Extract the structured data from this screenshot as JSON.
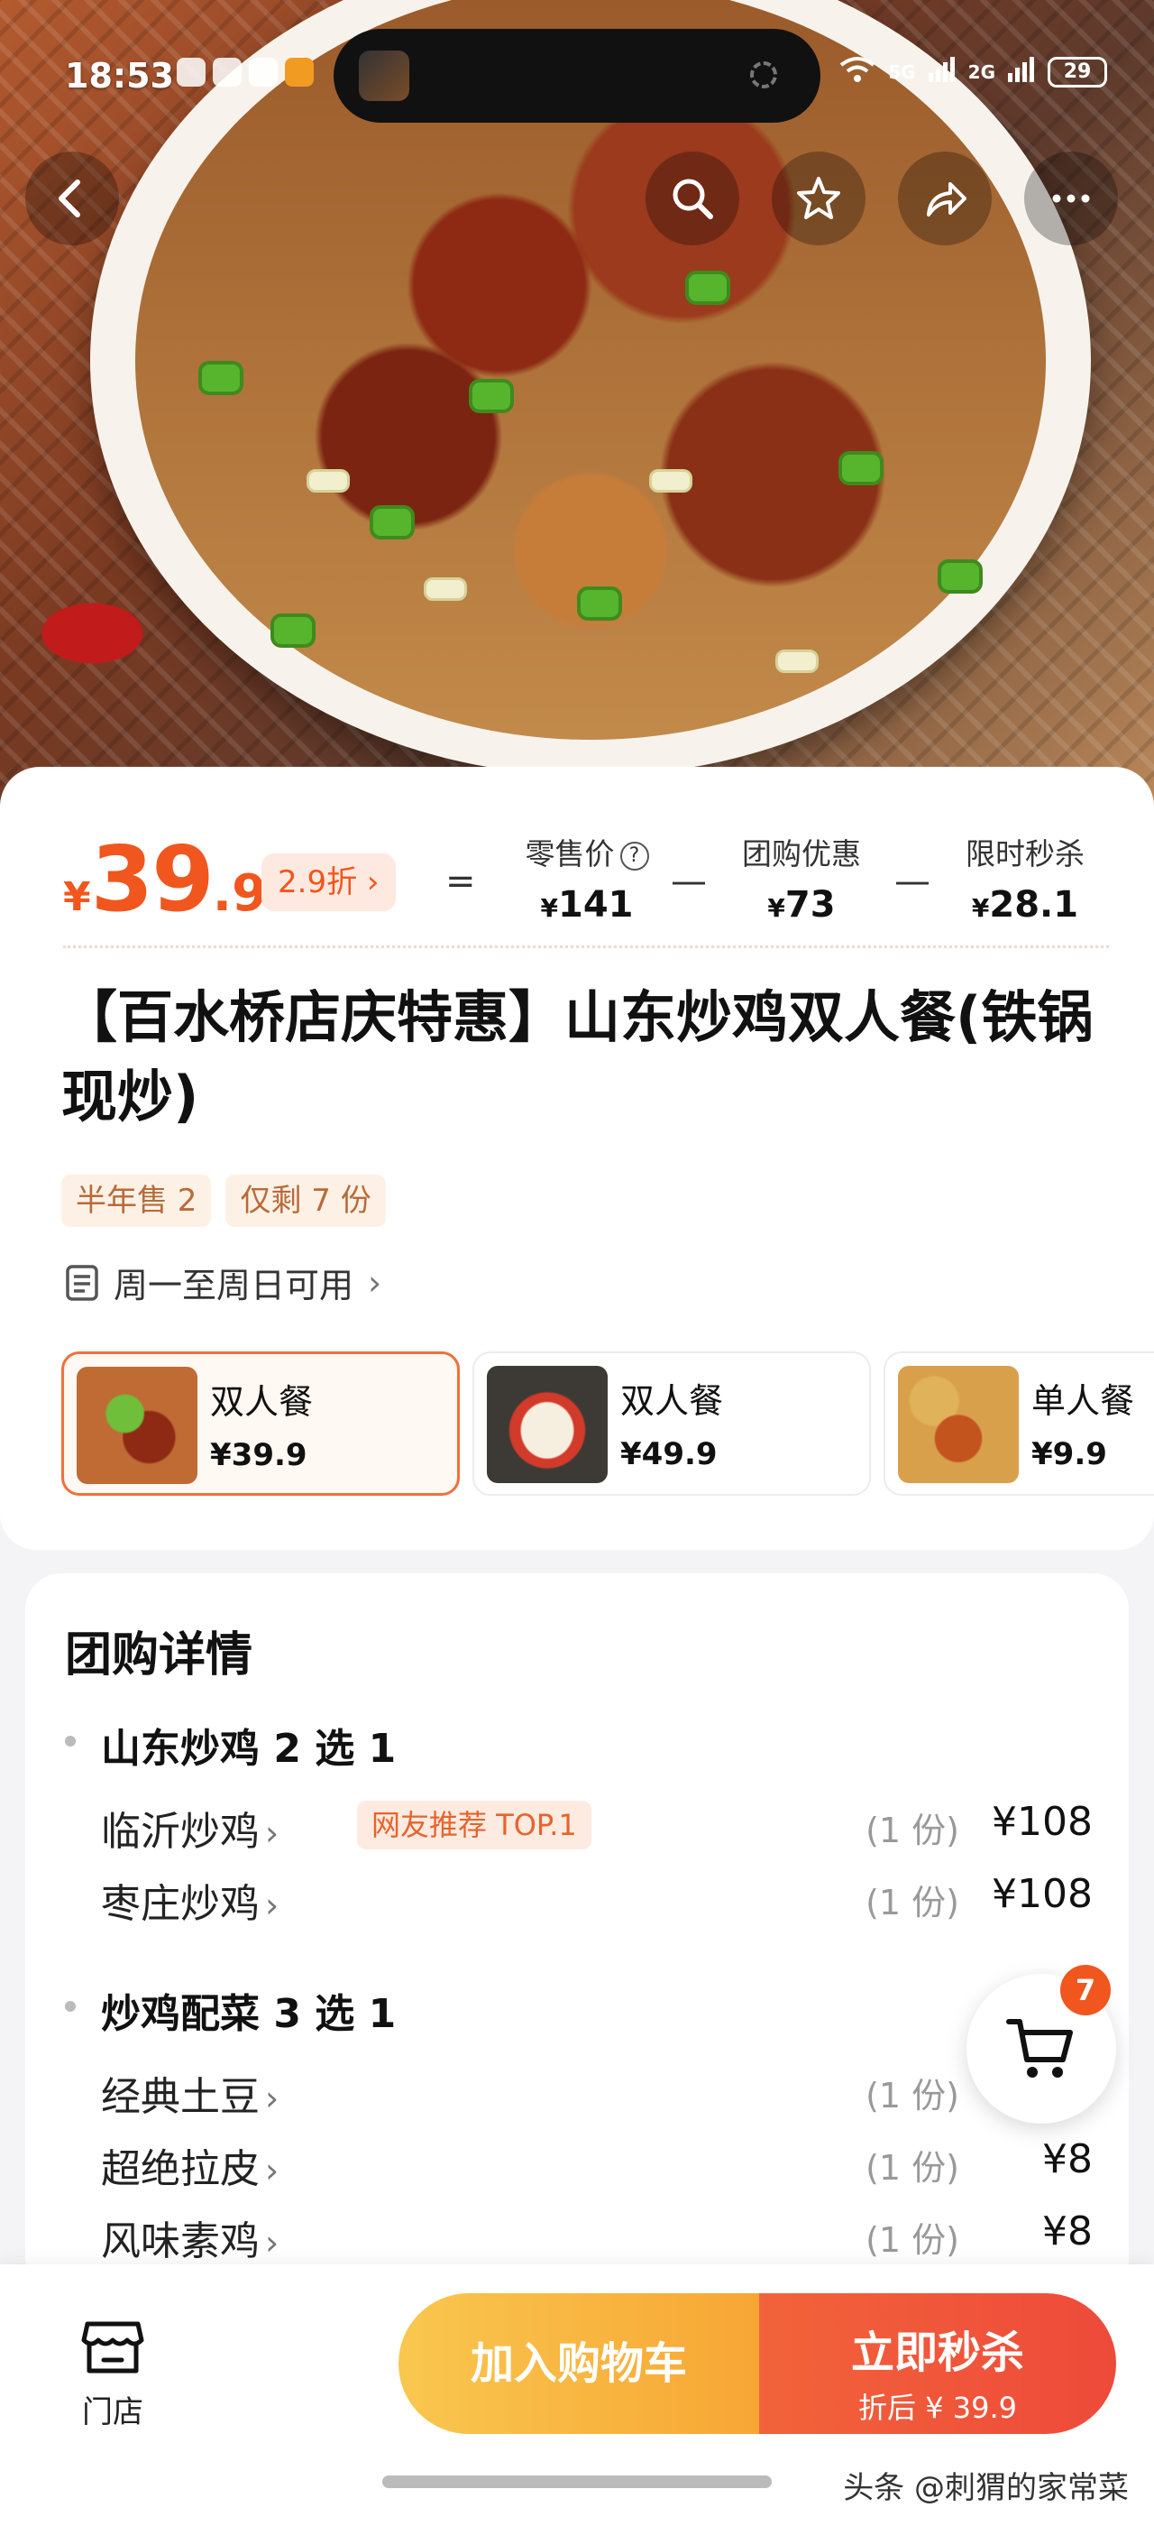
{
  "status_bar": {
    "time": "18:53",
    "network": "5G",
    "network2": "2G",
    "battery": "29"
  },
  "nav": {
    "back_icon": "chevron-left-icon",
    "search_icon": "search-icon",
    "favorite_icon": "star-icon",
    "share_icon": "share-icon",
    "more_icon": "more-icon"
  },
  "price_block": {
    "currency": "¥",
    "price_int": "39",
    "price_dec": ".9",
    "discount": "2.9折",
    "equals": "=",
    "retail_label": "零售价",
    "retail_help": "?",
    "retail_value": "141",
    "minus1": "—",
    "group_label": "团购优惠",
    "group_value": "73",
    "minus2": "—",
    "flash_label": "限时秒杀",
    "flash_value": "28.1"
  },
  "product": {
    "title": "【百水桥店庆特惠】山东炒鸡双人餐(铁锅现炒)",
    "sold": "半年售 2",
    "remaining": "仅剩 7 份",
    "availability": "周一至周日可用"
  },
  "options": [
    {
      "name": "双人餐",
      "price": "¥39.9"
    },
    {
      "name": "双人餐",
      "price": "¥49.9"
    },
    {
      "name": "单人餐",
      "price": "¥9.9"
    }
  ],
  "details": {
    "title": "团购详情",
    "group1_title": "山东炒鸡 2 选 1",
    "group1_items": [
      {
        "name": "临沂炒鸡",
        "badge": "网友推荐 TOP.1",
        "qty": "(1 份)",
        "price": "¥108"
      },
      {
        "name": "枣庄炒鸡",
        "qty": "(1 份)",
        "price": "¥108"
      }
    ],
    "group2_title": "炒鸡配菜 3 选 1",
    "group2_items": [
      {
        "name": "经典土豆",
        "qty": "(1 份)",
        "price": ""
      },
      {
        "name": "超绝拉皮",
        "qty": "(1 份)",
        "price": "¥8"
      },
      {
        "name": "风味素鸡",
        "qty": "(1 份)",
        "price": "¥8"
      }
    ]
  },
  "floating_cart": {
    "badge": "7"
  },
  "bottom_bar": {
    "store_label": "门店",
    "add_cart": "加入购物车",
    "buy_now": "立即秒杀",
    "buy_sub": "折后 ¥ 39.9"
  },
  "watermark": "头条 @刺猬的家常菜"
}
